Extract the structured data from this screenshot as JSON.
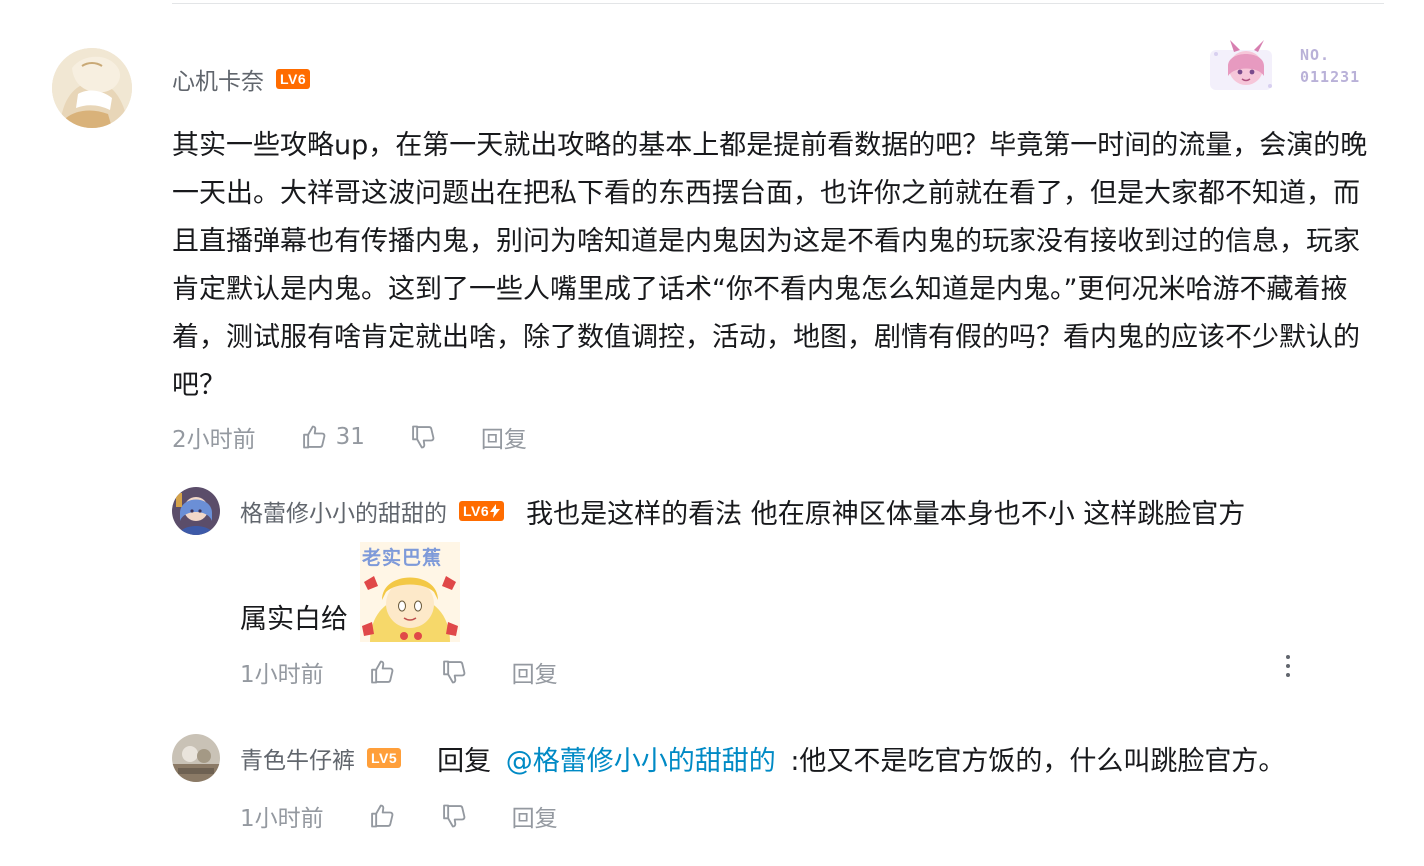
{
  "main_comment": {
    "username": "心机卡奈",
    "level": "LV6",
    "fan_badge": {
      "label": "NO.",
      "number": "011231"
    },
    "text": "其实一些攻略up，在第一天就出攻略的基本上都是提前看数据的吧？毕竟第一时间的流量，会演的晚一天出。大祥哥这波问题出在把私下看的东西摆台面，也许你之前就在看了，但是大家都不知道，而且直播弹幕也有传播内鬼，别问为啥知道是内鬼因为这是不看内鬼的玩家没有接收到过的信息，玩家肯定默认是内鬼。这到了一些人嘴里成了话术“你不看内鬼怎么知道是内鬼。”更何况米哈游不藏着掖着，测试服有啥肯定就出啥，除了数值调控，活动，地图，剧情有假的吗？看内鬼的应该不少默认的吧？",
    "time": "2小时前",
    "likes": "31",
    "reply_label": "回复"
  },
  "replies": [
    {
      "username": "格蕾修小小的甜甜的",
      "level": "LV6",
      "text_line1": "我也是这样的看法 他在原神区体量本身也不小 这样跳脸官方",
      "text_line2": "属实白给",
      "sticker_caption": "老实巴蕉",
      "time": "1小时前",
      "reply_label": "回复"
    },
    {
      "username": "青色牛仔裤",
      "level": "LV5",
      "reply_prefix": "回复",
      "mention": "@格蕾修小小的甜甜的",
      "text": ":他又不是吃官方饭的，什么叫跳脸官方。",
      "time": "1小时前",
      "reply_label": "回复"
    }
  ],
  "colors": {
    "username": "#61666d",
    "meta": "#9499a0",
    "lv6": "#ff6c00",
    "lv5": "#ff9f3a",
    "mention": "#008ac5",
    "text": "#18191c"
  },
  "icons": [
    "thumbs-up-icon",
    "thumbs-down-icon",
    "more-vertical-icon"
  ]
}
